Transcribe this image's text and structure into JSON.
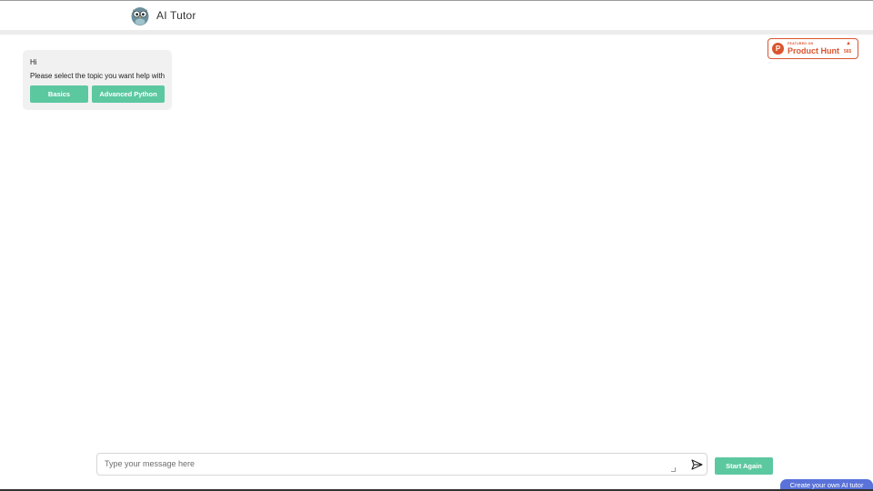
{
  "header": {
    "title": "AI Tutor",
    "logo_icon": "owl-logo-icon"
  },
  "badge": {
    "featured": "FEATURED ON",
    "name": "Product Hunt",
    "votes": "565",
    "color": "#da552f"
  },
  "chat": {
    "greeting": "Hi",
    "prompt": "Please select the topic you want help with",
    "topics": [
      "Basics",
      "Advanced Python"
    ]
  },
  "composer": {
    "placeholder": "Type your message here",
    "send_icon": "send-icon",
    "start_again": "Start Again"
  },
  "footer": {
    "create_label": "Create your own AI tutor"
  },
  "colors": {
    "accent": "#5cc8a0",
    "tab": "#5a72d9",
    "bubble": "#f1f1f1"
  }
}
